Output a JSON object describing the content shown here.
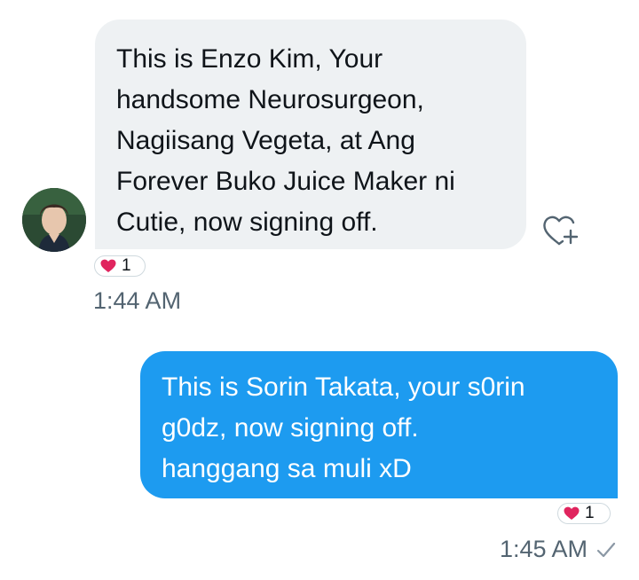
{
  "incoming_message": {
    "text": "This is Enzo Kim, Your\nhandsome Neurosurgeon,\nNagiisang Vegeta, at Ang\nForever Buko Juice Maker ni\nCutie, now signing off.",
    "reaction_count": "1",
    "timestamp": "1:44 AM",
    "bubble_color": "#eef1f3"
  },
  "outgoing_message": {
    "text": "This is Sorin Takata, your s0rin\ng0dz, now signing off.\nhanggang sa muli xD",
    "reaction_count": "1",
    "timestamp": "1:45 AM",
    "bubble_color": "#1d9bf0"
  },
  "icons": {
    "react": "heart-plus-icon",
    "reaction": "heart-icon",
    "read_status": "checkmark-icon"
  },
  "colors": {
    "heart": "#e0245e",
    "muted_text": "#536471"
  }
}
